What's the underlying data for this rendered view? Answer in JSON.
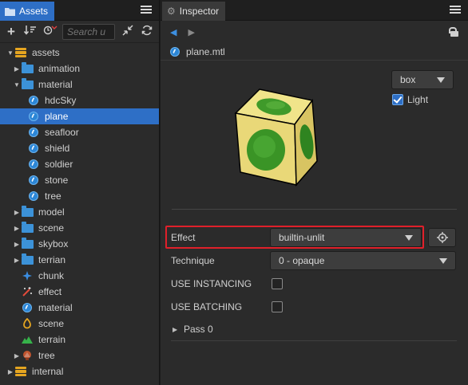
{
  "assets_panel": {
    "tab_label": "Assets",
    "search_placeholder": "Search u",
    "tree": [
      {
        "label": "assets",
        "depth": 0,
        "expanded": true,
        "icon": "database-icon"
      },
      {
        "label": "animation",
        "depth": 1,
        "expanded": false,
        "icon": "folder-icon"
      },
      {
        "label": "material",
        "depth": 1,
        "expanded": true,
        "icon": "folder-icon"
      },
      {
        "label": "hdcSky",
        "depth": 2,
        "icon": "material-icon"
      },
      {
        "label": "plane",
        "depth": 2,
        "icon": "material-icon",
        "selected": true
      },
      {
        "label": "seafloor",
        "depth": 2,
        "icon": "material-icon"
      },
      {
        "label": "shield",
        "depth": 2,
        "icon": "material-icon"
      },
      {
        "label": "soldier",
        "depth": 2,
        "icon": "material-icon"
      },
      {
        "label": "stone",
        "depth": 2,
        "icon": "material-icon"
      },
      {
        "label": "tree",
        "depth": 2,
        "icon": "material-icon"
      },
      {
        "label": "model",
        "depth": 1,
        "expanded": false,
        "icon": "folder-icon"
      },
      {
        "label": "scene",
        "depth": 1,
        "expanded": false,
        "icon": "folder-icon"
      },
      {
        "label": "skybox",
        "depth": 1,
        "expanded": false,
        "icon": "folder-icon"
      },
      {
        "label": "terrian",
        "depth": 1,
        "expanded": false,
        "icon": "folder-icon"
      },
      {
        "label": "chunk",
        "depth": 1,
        "icon": "particle-icon"
      },
      {
        "label": "effect",
        "depth": 1,
        "icon": "effect-icon"
      },
      {
        "label": "material",
        "depth": 1,
        "icon": "material-icon"
      },
      {
        "label": "scene",
        "depth": 1,
        "icon": "scene-icon"
      },
      {
        "label": "terrain",
        "depth": 1,
        "icon": "terrain-icon"
      },
      {
        "label": "tree",
        "depth": 1,
        "expanded": false,
        "icon": "prefab-icon"
      },
      {
        "label": "internal",
        "depth": 0,
        "expanded": false,
        "icon": "database-icon"
      }
    ]
  },
  "inspector": {
    "tab_label": "Inspector",
    "file_name": "plane.mtl",
    "preview": {
      "mesh_select": "box",
      "light_label": "Light",
      "light_checked": true
    },
    "effect": {
      "label": "Effect",
      "value": "builtin-unlit"
    },
    "technique": {
      "label": "Technique",
      "value": "0 - opaque"
    },
    "use_instancing": {
      "label": "USE INSTANCING",
      "checked": false
    },
    "use_batching": {
      "label": "USE BATCHING",
      "checked": false
    },
    "pass": {
      "label": "Pass 0"
    }
  },
  "colors": {
    "accent": "#2e6fc6",
    "folder": "#3c92d8",
    "highlight_border": "#e0202a",
    "panel_bg": "#2b2b2b"
  }
}
